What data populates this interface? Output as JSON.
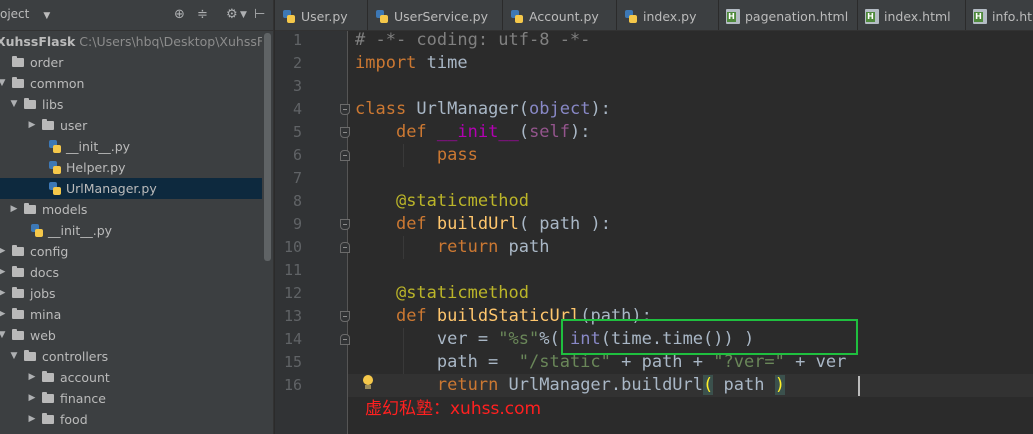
{
  "project_panel": {
    "title": "oject",
    "icons": [
      "target-icon",
      "collapse-icon",
      "gear-icon",
      "hide-icon"
    ],
    "tree": [
      {
        "label": "XuhssFlask",
        "path": "C:\\Users\\hbq\\Desktop\\XuhssFlask",
        "kind": "root",
        "depth": 0,
        "arrow": ""
      },
      {
        "label": "order",
        "kind": "folder",
        "depth": 0,
        "arrow": ""
      },
      {
        "label": "common",
        "kind": "folder",
        "depth": 0,
        "arrow": "▼"
      },
      {
        "label": "libs",
        "kind": "folder",
        "depth": 1,
        "arrow": "▼"
      },
      {
        "label": "user",
        "kind": "folder",
        "depth": 2,
        "arrow": "▶"
      },
      {
        "label": "__init__.py",
        "kind": "py",
        "depth": 2,
        "arrow": ""
      },
      {
        "label": "Helper.py",
        "kind": "py",
        "depth": 2,
        "arrow": ""
      },
      {
        "label": "UrlManager.py",
        "kind": "py",
        "depth": 2,
        "arrow": "",
        "selected": true
      },
      {
        "label": "models",
        "kind": "folder",
        "depth": 1,
        "arrow": "▶"
      },
      {
        "label": "__init__.py",
        "kind": "py",
        "depth": 1,
        "arrow": ""
      },
      {
        "label": "config",
        "kind": "folder",
        "depth": 0,
        "arrow": "▶"
      },
      {
        "label": "docs",
        "kind": "folder",
        "depth": 0,
        "arrow": "▶"
      },
      {
        "label": "jobs",
        "kind": "folder",
        "depth": 0,
        "arrow": "▶"
      },
      {
        "label": "mina",
        "kind": "folder",
        "depth": 0,
        "arrow": "▶"
      },
      {
        "label": "web",
        "kind": "folder",
        "depth": 0,
        "arrow": "▼"
      },
      {
        "label": "controllers",
        "kind": "folder",
        "depth": 1,
        "arrow": "▼"
      },
      {
        "label": "account",
        "kind": "folder",
        "depth": 2,
        "arrow": "▶"
      },
      {
        "label": "finance",
        "kind": "folder",
        "depth": 2,
        "arrow": "▶"
      },
      {
        "label": "food",
        "kind": "folder",
        "depth": 2,
        "arrow": "▶"
      }
    ]
  },
  "tabs": [
    {
      "label": "User.py",
      "icon": "py"
    },
    {
      "label": "UserService.py",
      "icon": "py"
    },
    {
      "label": "Account.py",
      "icon": "py"
    },
    {
      "label": "index.py",
      "icon": "py"
    },
    {
      "label": "pagenation.html",
      "icon": "html"
    },
    {
      "label": "index.html",
      "icon": "html"
    },
    {
      "label": "info.htm",
      "icon": "html"
    }
  ],
  "editor": {
    "line_numbers": [
      "1",
      "2",
      "3",
      "4",
      "5",
      "6",
      "7",
      "8",
      "9",
      "10",
      "11",
      "12",
      "13",
      "14",
      "15",
      "16"
    ],
    "current_line": 16,
    "lines": [
      [
        [
          "cm",
          "# -*- coding: utf-8 -*-"
        ]
      ],
      [
        [
          "kw",
          "import"
        ],
        [
          "tx",
          " time"
        ]
      ],
      [],
      [
        [
          "kw",
          "class"
        ],
        [
          "tx",
          " UrlManager("
        ],
        [
          "bi",
          "object"
        ],
        [
          "tx",
          "):"
        ]
      ],
      [
        [
          "tx",
          "    "
        ],
        [
          "kw",
          "def"
        ],
        [
          "tx",
          " "
        ],
        [
          "dn",
          "__init__"
        ],
        [
          "tx",
          "("
        ],
        [
          "sf",
          "self"
        ],
        [
          "tx",
          "):"
        ]
      ],
      [
        [
          "tx",
          "        "
        ],
        [
          "kw",
          "pass"
        ]
      ],
      [],
      [
        [
          "tx",
          "    "
        ],
        [
          "dc",
          "@staticmethod"
        ]
      ],
      [
        [
          "tx",
          "    "
        ],
        [
          "kw",
          "def"
        ],
        [
          "tx",
          " "
        ],
        [
          "fn",
          "buildUrl"
        ],
        [
          "tx",
          "( path ):"
        ]
      ],
      [
        [
          "tx",
          "        "
        ],
        [
          "kw",
          "return"
        ],
        [
          "tx",
          " path"
        ]
      ],
      [],
      [
        [
          "tx",
          "    "
        ],
        [
          "dc",
          "@staticmethod"
        ]
      ],
      [
        [
          "tx",
          "    "
        ],
        [
          "kw",
          "def"
        ],
        [
          "tx",
          " "
        ],
        [
          "fn",
          "buildStaticUrl"
        ],
        [
          "tx",
          "(path):"
        ]
      ],
      [
        [
          "tx",
          "        ver = "
        ],
        [
          "st",
          "\"%s\""
        ],
        [
          "tx",
          "%( "
        ],
        [
          "bi",
          "int"
        ],
        [
          "tx",
          "(time.time()) )"
        ]
      ],
      [
        [
          "tx",
          "        path =  "
        ],
        [
          "st",
          "\"/static\""
        ],
        [
          "tx",
          " + path + "
        ],
        [
          "st",
          "\"?ver=\""
        ],
        [
          "tx",
          " + ver"
        ]
      ],
      [
        [
          "tx",
          "        "
        ],
        [
          "kw",
          "return"
        ],
        [
          "tx",
          " UrlManager.buildUrl"
        ],
        [
          "bm",
          "("
        ],
        [
          "tx",
          " path "
        ],
        [
          "bm",
          ")"
        ]
      ]
    ]
  },
  "watermark": "虚幻私塾：xuhss.com"
}
